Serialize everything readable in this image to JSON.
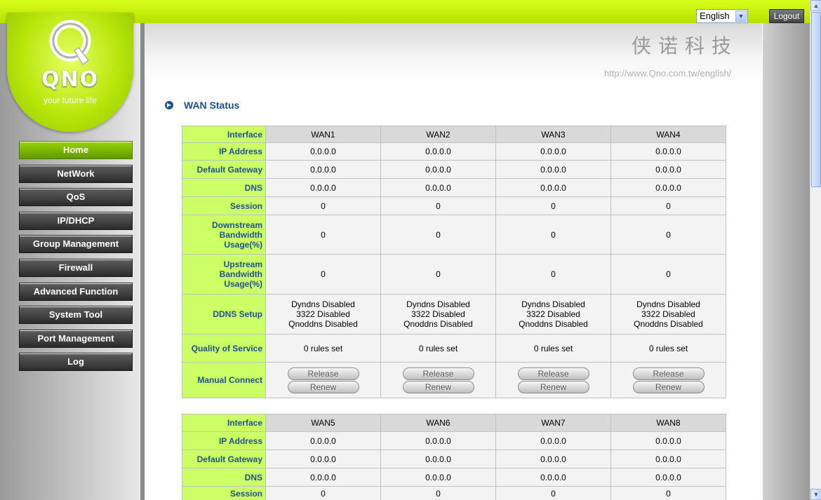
{
  "header": {
    "language": "English",
    "logout_label": "Logout",
    "url_text": "http://www.Qno.com.tw/english/",
    "chinese_text": "侠诺科技"
  },
  "logo": {
    "brand": "QNO",
    "tagline": "your future life"
  },
  "nav": {
    "items": [
      {
        "label": "Home",
        "active": true
      },
      {
        "label": "NetWork"
      },
      {
        "label": "QoS"
      },
      {
        "label": "IP/DHCP"
      },
      {
        "label": "Group Management"
      },
      {
        "label": "Firewall"
      },
      {
        "label": "Advanced Function"
      },
      {
        "label": "System Tool"
      },
      {
        "label": "Port Management"
      },
      {
        "label": "Log"
      }
    ]
  },
  "page": {
    "title": "WAN Status"
  },
  "labels": {
    "interface": "Interface",
    "ip": "IP Address",
    "gateway": "Default Gateway",
    "dns": "DNS",
    "session": "Session",
    "downstream": "Downstream Bandwidth Usage(%)",
    "upstream": "Upstream Bandwidth Usage(%)",
    "ddns": "DDNS Setup",
    "qos": "Quality of Service",
    "manual": "Manual Connect",
    "release": "Release",
    "renew": "Renew"
  },
  "table1": {
    "wans": [
      {
        "name": "WAN1",
        "ip": "0.0.0.0",
        "gateway": "0.0.0.0",
        "dns": "0.0.0.0",
        "session": "0",
        "down": "0",
        "up": "0",
        "ddns1": "Dyndns Disabled",
        "ddns2": "3322 Disabled",
        "ddns3": "Qnoddns Disabled",
        "qos": "0 rules set"
      },
      {
        "name": "WAN2",
        "ip": "0.0.0.0",
        "gateway": "0.0.0.0",
        "dns": "0.0.0.0",
        "session": "0",
        "down": "0",
        "up": "0",
        "ddns1": "Dyndns Disabled",
        "ddns2": "3322 Disabled",
        "ddns3": "Qnoddns Disabled",
        "qos": "0 rules set"
      },
      {
        "name": "WAN3",
        "ip": "0.0.0.0",
        "gateway": "0.0.0.0",
        "dns": "0.0.0.0",
        "session": "0",
        "down": "0",
        "up": "0",
        "ddns1": "Dyndns Disabled",
        "ddns2": "3322 Disabled",
        "ddns3": "Qnoddns Disabled",
        "qos": "0 rules set"
      },
      {
        "name": "WAN4",
        "ip": "0.0.0.0",
        "gateway": "0.0.0.0",
        "dns": "0.0.0.0",
        "session": "0",
        "down": "0",
        "up": "0",
        "ddns1": "Dyndns Disabled",
        "ddns2": "3322 Disabled",
        "ddns3": "Qnoddns Disabled",
        "qos": "0 rules set"
      }
    ]
  },
  "table2": {
    "wans": [
      {
        "name": "WAN5",
        "ip": "0.0.0.0",
        "gateway": "0.0.0.0",
        "dns": "0.0.0.0",
        "session": "0"
      },
      {
        "name": "WAN6",
        "ip": "0.0.0.0",
        "gateway": "0.0.0.0",
        "dns": "0.0.0.0",
        "session": "0"
      },
      {
        "name": "WAN7",
        "ip": "0.0.0.0",
        "gateway": "0.0.0.0",
        "dns": "0.0.0.0",
        "session": "0"
      },
      {
        "name": "WAN8",
        "ip": "0.0.0.0",
        "gateway": "0.0.0.0",
        "dns": "0.0.0.0",
        "session": "0"
      }
    ]
  },
  "colors": {
    "accent_lime": "#ccff66",
    "title_blue": "#1d4f91"
  }
}
